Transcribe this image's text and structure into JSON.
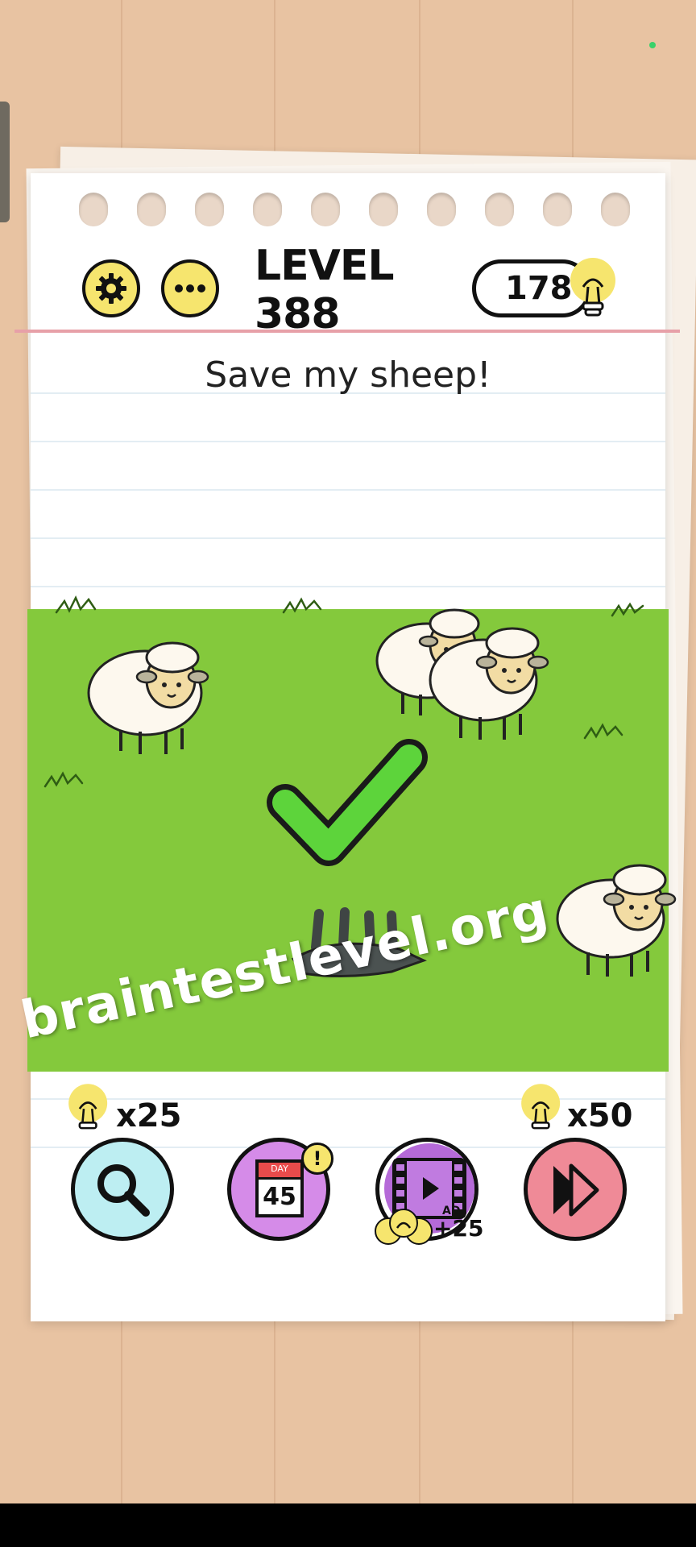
{
  "header": {
    "level_title": "LEVEL 388",
    "hint_count": "178"
  },
  "question": "Save my sheep!",
  "result": {
    "state": "correct"
  },
  "actions": {
    "search_cost": "x25",
    "daily_day_label": "DAY",
    "daily_day_number": "45",
    "daily_badge": "!",
    "ad_label": "AD",
    "ad_reward": "+25",
    "skip_cost": "x50"
  },
  "watermark": "braintestlevel.org",
  "colors": {
    "grass": "#84c93c",
    "accent_yellow": "#f6e56e",
    "check_green": "#5dd43b",
    "search_bg": "#bdeef2",
    "daily_bg": "#d58be8",
    "ad_bg": "#b56ad8",
    "skip_bg": "#ef8a97"
  }
}
